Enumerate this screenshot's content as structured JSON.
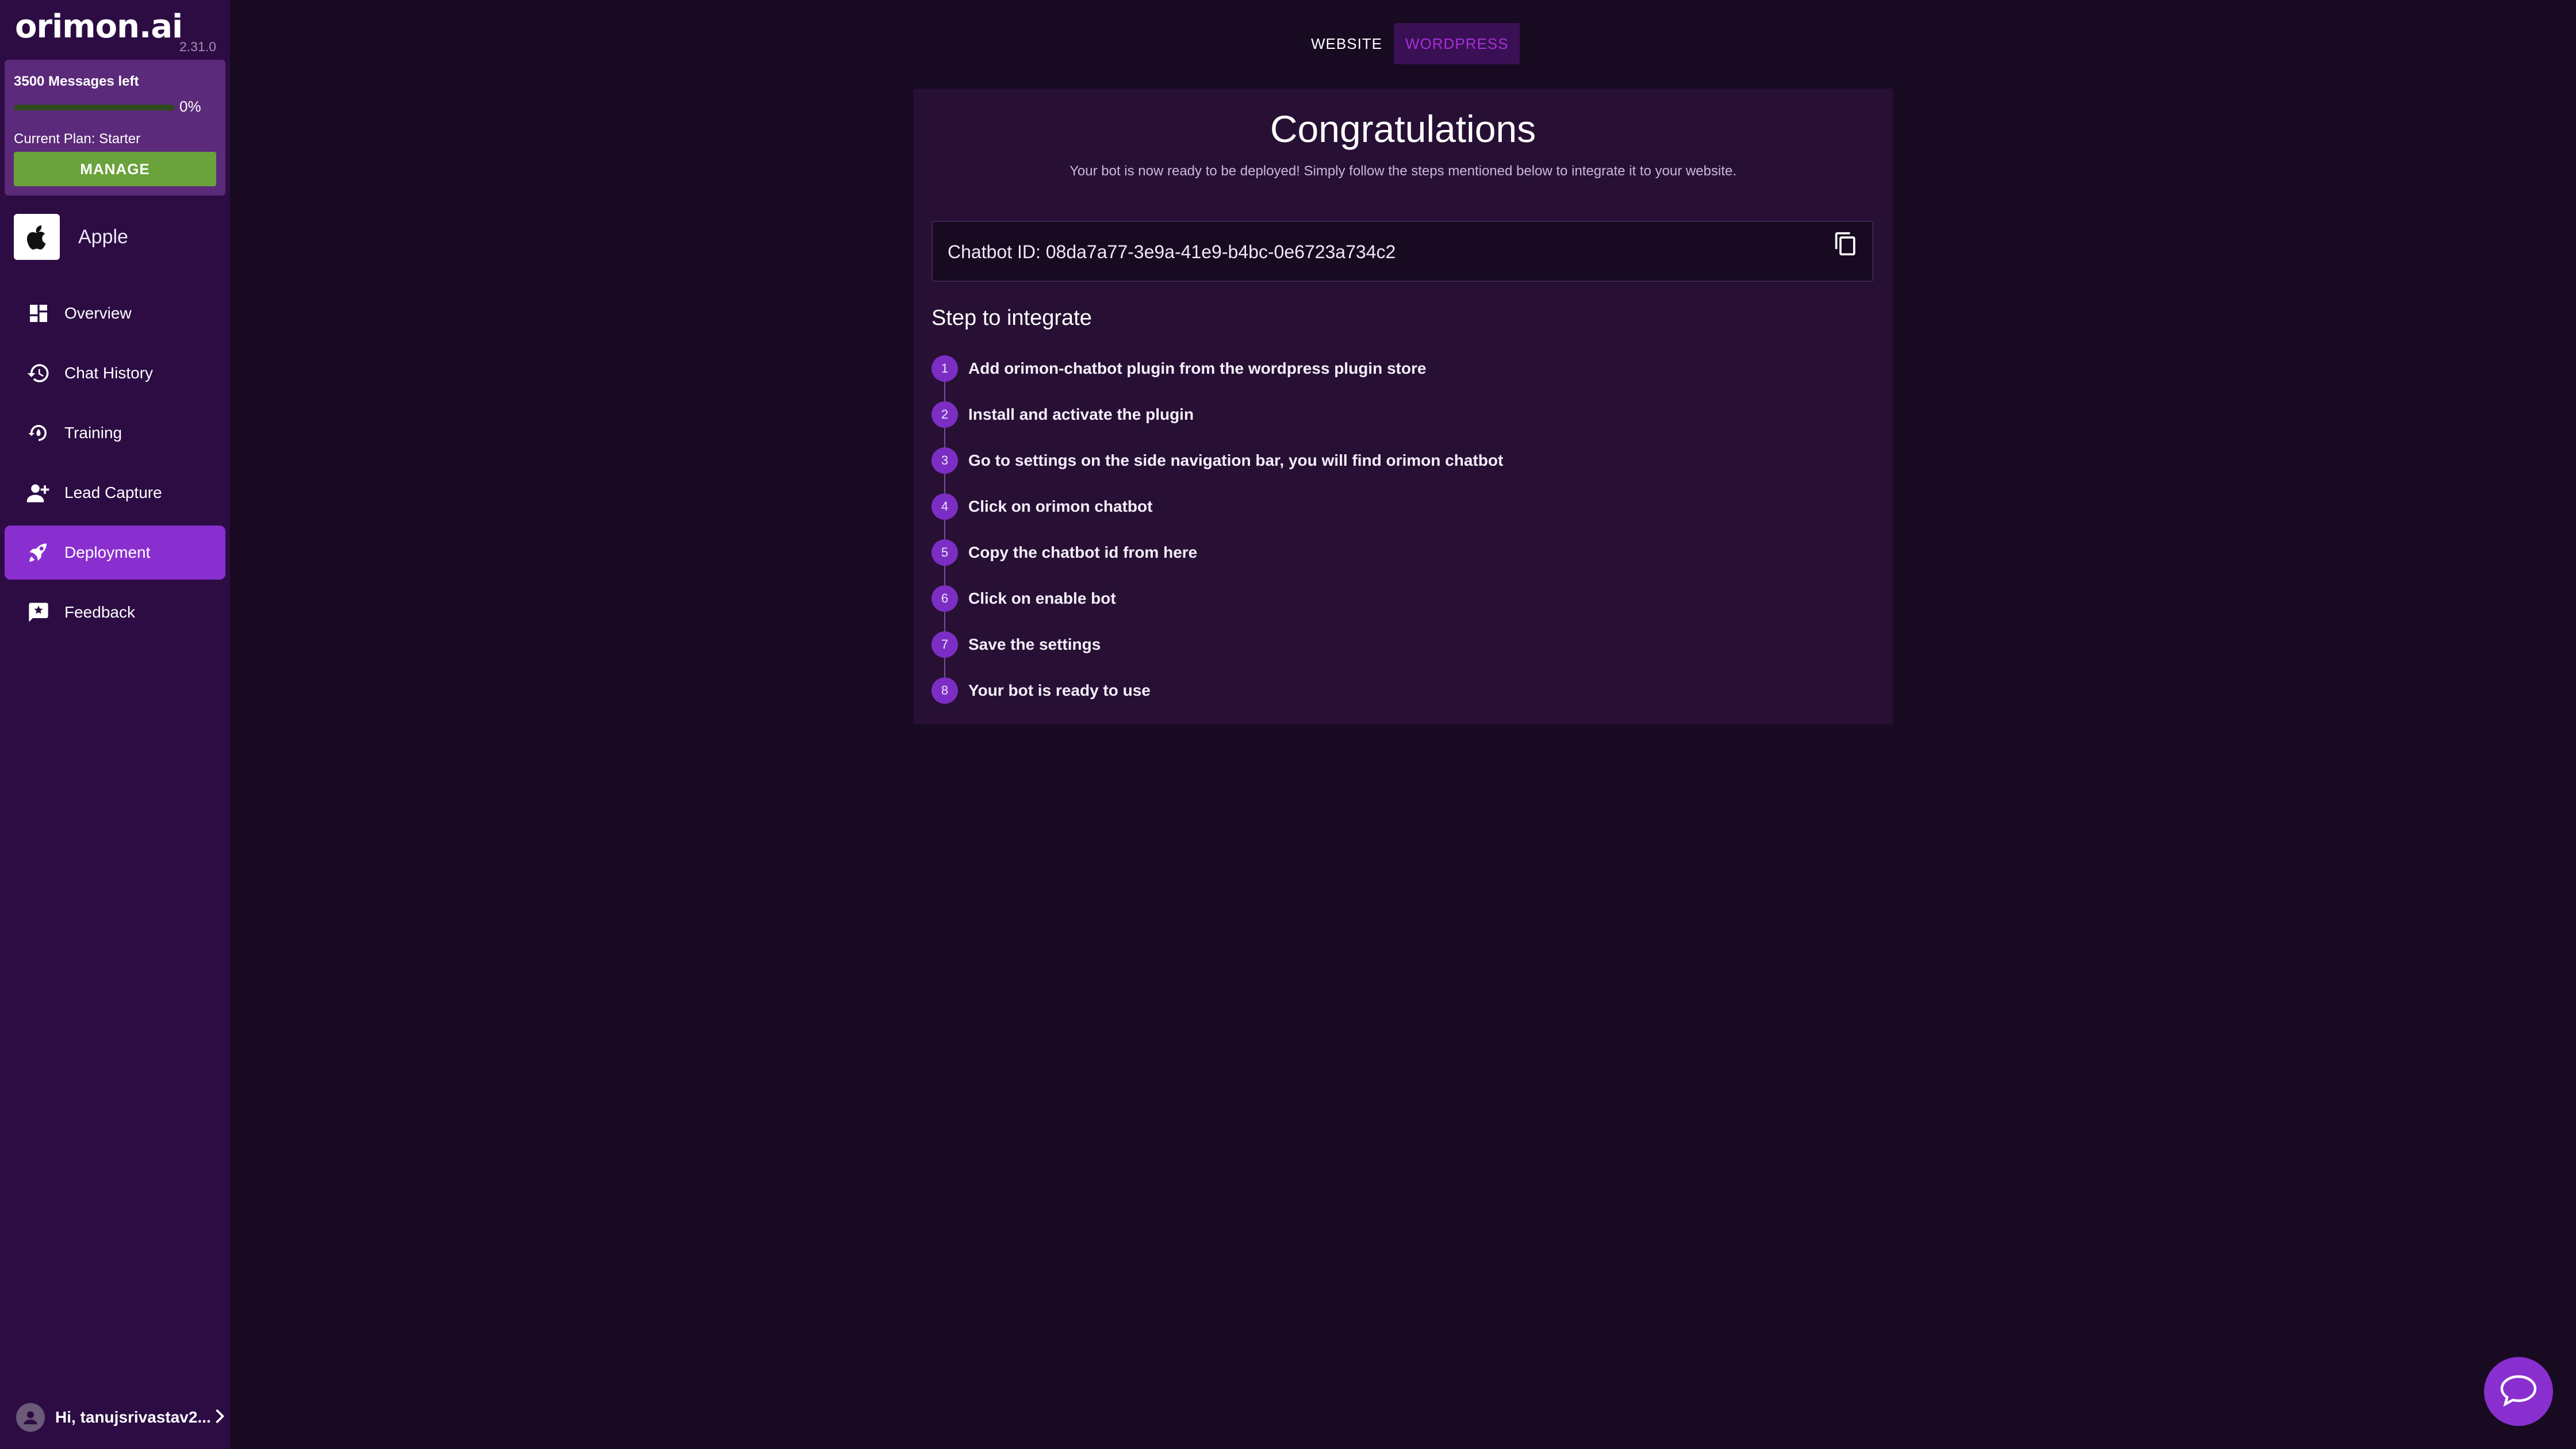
{
  "brand": {
    "logo": "orimon.ai",
    "version": "2.31.0"
  },
  "plan": {
    "messages_left": "3500 Messages left",
    "usage_percent_label": "0%",
    "usage_fraction": 0,
    "current_plan": "Current Plan: Starter",
    "manage_label": "MANAGE"
  },
  "bot": {
    "name": "Apple",
    "icon": "apple-logo-icon"
  },
  "nav": {
    "items": [
      {
        "label": "Overview",
        "icon": "dashboard-icon"
      },
      {
        "label": "Chat History",
        "icon": "history-icon"
      },
      {
        "label": "Training",
        "icon": "training-icon"
      },
      {
        "label": "Lead Capture",
        "icon": "add-user-icon"
      },
      {
        "label": "Deployment",
        "icon": "rocket-icon",
        "active": true
      },
      {
        "label": "Feedback",
        "icon": "feedback-icon"
      }
    ]
  },
  "user": {
    "greeting": "Hi, tanujsrivastav2..."
  },
  "tabs": {
    "website": "WEBSITE",
    "wordpress": "WORDPRESS",
    "active": "WORDPRESS"
  },
  "main": {
    "title": "Congratulations",
    "subtitle": "Your bot is now ready to be deployed! Simply follow the steps mentioned below to integrate it to your website.",
    "chatbot_id": "Chatbot ID: 08da7a77-3e9a-41e9-b4bc-0e6723a734c2",
    "steps_title": "Step to integrate",
    "steps": [
      {
        "num": "1",
        "text": "Add orimon-chatbot plugin from the wordpress plugin store"
      },
      {
        "num": "2",
        "text": "Install and activate the plugin"
      },
      {
        "num": "3",
        "text": "Go to settings on the side navigation bar, you will find orimon chatbot"
      },
      {
        "num": "4",
        "text": "Click on orimon chatbot"
      },
      {
        "num": "5",
        "text": "Copy the chatbot id from here"
      },
      {
        "num": "6",
        "text": "Click on enable bot"
      },
      {
        "num": "7",
        "text": "Save the settings"
      },
      {
        "num": "8",
        "text": "Your bot is ready to use"
      }
    ]
  },
  "colors": {
    "background": "#170a21",
    "sidebar": "#2c0c43",
    "accent": "#8a2fcf",
    "manage_green": "#6aa23c",
    "wordpress_tab_text": "#a62fd6"
  }
}
